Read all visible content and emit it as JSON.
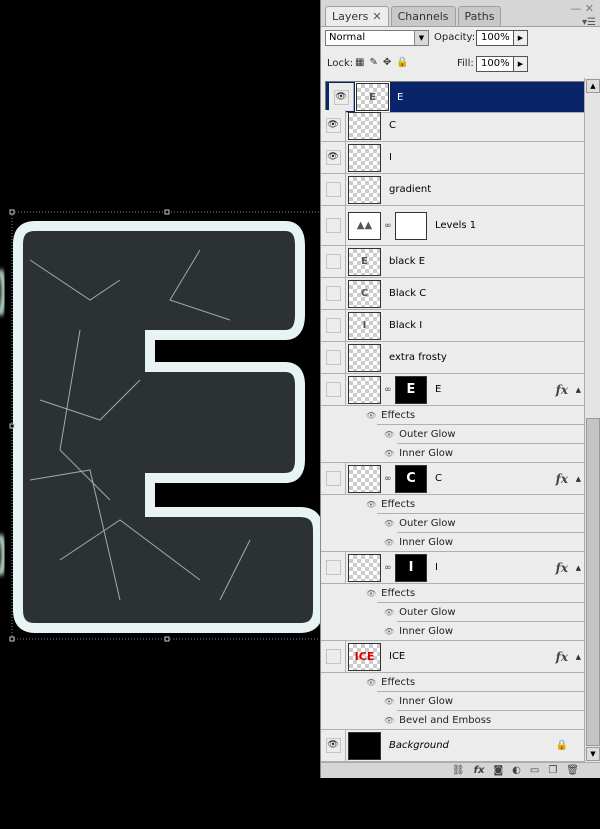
{
  "panel": {
    "tabs": [
      {
        "label": "Layers",
        "active": true
      },
      {
        "label": "Channels"
      },
      {
        "label": "Paths"
      }
    ],
    "blend_mode": "Normal",
    "opacity_label": "Opacity:",
    "opacity": "100%",
    "lock_label": "Lock:",
    "fill_label": "Fill:",
    "fill": "100%"
  },
  "layers": [
    {
      "type": "layer",
      "name": "E",
      "visible": true,
      "selected": true,
      "thumb": "E"
    },
    {
      "type": "layer",
      "name": "C",
      "visible": true,
      "thumb": ""
    },
    {
      "type": "layer",
      "name": "I",
      "visible": true,
      "thumb": ""
    },
    {
      "type": "layer",
      "name": "gradient",
      "visible": false,
      "thumb": ""
    },
    {
      "type": "adjust",
      "name": "Levels 1",
      "visible": false
    },
    {
      "type": "layer",
      "name": "black E",
      "visible": false,
      "thumb": "E"
    },
    {
      "type": "layer",
      "name": "Black C",
      "visible": false,
      "thumb": "C"
    },
    {
      "type": "layer",
      "name": "Black I",
      "visible": false,
      "thumb": "I"
    },
    {
      "type": "layer",
      "name": "extra frosty",
      "visible": false,
      "thumb": ""
    },
    {
      "type": "masked",
      "name": "E",
      "mask": "E",
      "fx": true,
      "visible": false
    },
    {
      "type": "sub",
      "name": "Effects",
      "level": 1
    },
    {
      "type": "sub",
      "name": "Outer Glow",
      "level": 2
    },
    {
      "type": "sub",
      "name": "Inner Glow",
      "level": 2
    },
    {
      "type": "masked",
      "name": "C",
      "mask": "C",
      "fx": true,
      "visible": false
    },
    {
      "type": "sub",
      "name": "Effects",
      "level": 1
    },
    {
      "type": "sub",
      "name": "Outer Glow",
      "level": 2
    },
    {
      "type": "sub",
      "name": "Inner Glow",
      "level": 2
    },
    {
      "type": "masked",
      "name": "I",
      "mask": "I",
      "fx": true,
      "visible": false
    },
    {
      "type": "sub",
      "name": "Effects",
      "level": 1
    },
    {
      "type": "sub",
      "name": "Outer Glow",
      "level": 2
    },
    {
      "type": "sub",
      "name": "Inner Glow",
      "level": 2
    },
    {
      "type": "smart",
      "name": "ICE",
      "fx": true,
      "visible": false,
      "thumb": "ICE"
    },
    {
      "type": "sub",
      "name": "Effects",
      "level": 1
    },
    {
      "type": "sub",
      "name": "Inner Glow",
      "level": 2
    },
    {
      "type": "sub",
      "name": "Bevel and Emboss",
      "level": 2
    },
    {
      "type": "background",
      "name": "Background",
      "visible": true,
      "locked": true
    }
  ],
  "colors": {
    "selected": "#0a246a",
    "ice_thumb": "#e00000"
  }
}
